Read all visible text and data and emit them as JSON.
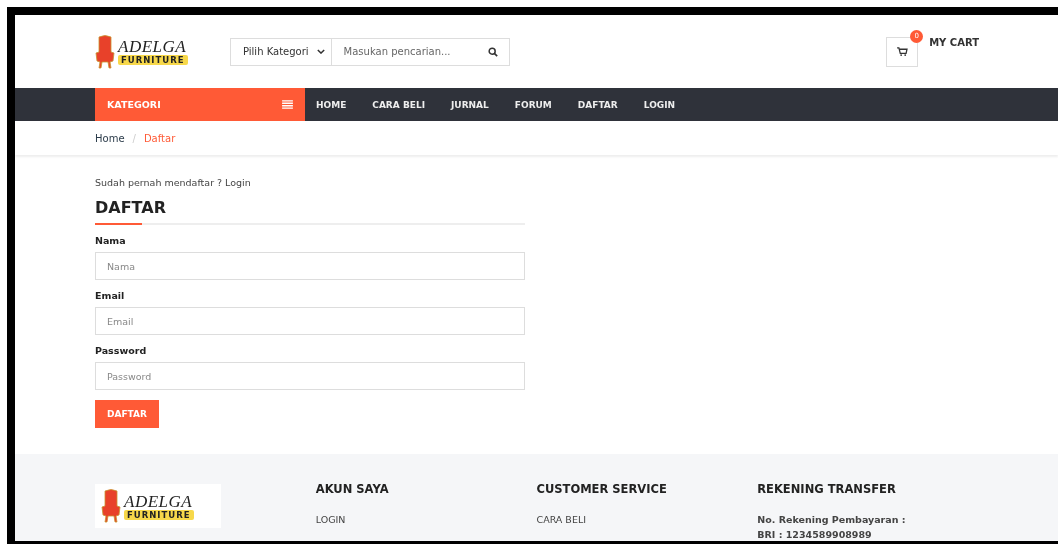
{
  "header": {
    "logo": {
      "script": "ADELGA",
      "word": "FURNITURE"
    },
    "category_select": {
      "value": "Pilih Kategori"
    },
    "search": {
      "placeholder": "Masukan pencarian..."
    },
    "cart": {
      "count": "0",
      "label": "MY CART"
    }
  },
  "nav": {
    "category_label": "KATEGORI",
    "items": [
      {
        "label": "HOME"
      },
      {
        "label": "CARA BELI"
      },
      {
        "label": "JURNAL"
      },
      {
        "label": "FORUM"
      },
      {
        "label": "DAFTAR"
      },
      {
        "label": "LOGIN"
      }
    ]
  },
  "breadcrumb": {
    "separator": "/",
    "items": [
      {
        "label": "Home",
        "current": false
      },
      {
        "label": "Daftar",
        "current": true
      }
    ]
  },
  "form": {
    "intro": "Sudah pernah mendaftar ? Login",
    "title": "DAFTAR",
    "fields": [
      {
        "label": "Nama",
        "placeholder": "Nama"
      },
      {
        "label": "Email",
        "placeholder": "Email"
      },
      {
        "label": "Password",
        "placeholder": "Password"
      }
    ],
    "submit": "DAFTAR"
  },
  "footer": {
    "logo": {
      "script": "ADELGA",
      "word": "FURNITURE"
    },
    "columns": [
      {
        "title": "AKUN SAYA",
        "links": [
          "LOGIN"
        ]
      },
      {
        "title": "CUSTOMER SERVICE",
        "links": [
          "CARA BELI"
        ]
      },
      {
        "title": "REKENING TRANSFER",
        "lines": [
          "No. Rekening Pembayaran :",
          "BRI : 1234589908989"
        ]
      }
    ]
  }
}
